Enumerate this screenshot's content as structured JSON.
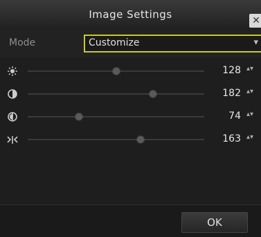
{
  "dialog": {
    "title": "Image Settings",
    "close_label": "✕"
  },
  "mode": {
    "label": "Mode",
    "value": "Customize",
    "arrow": "▾"
  },
  "sliders": [
    {
      "icon": "brightness-icon",
      "value": "128",
      "level": 0.5
    },
    {
      "icon": "contrast-icon",
      "value": "182",
      "level": 0.71
    },
    {
      "icon": "saturation-icon",
      "value": "74",
      "level": 0.29
    },
    {
      "icon": "hue-icon",
      "value": "163",
      "level": 0.64
    }
  ],
  "spinner_glyph": "▴▾",
  "footer": {
    "ok_label": "OK"
  },
  "colors": {
    "accent_border": "#c9c92b",
    "background": "#1e1e1e"
  }
}
